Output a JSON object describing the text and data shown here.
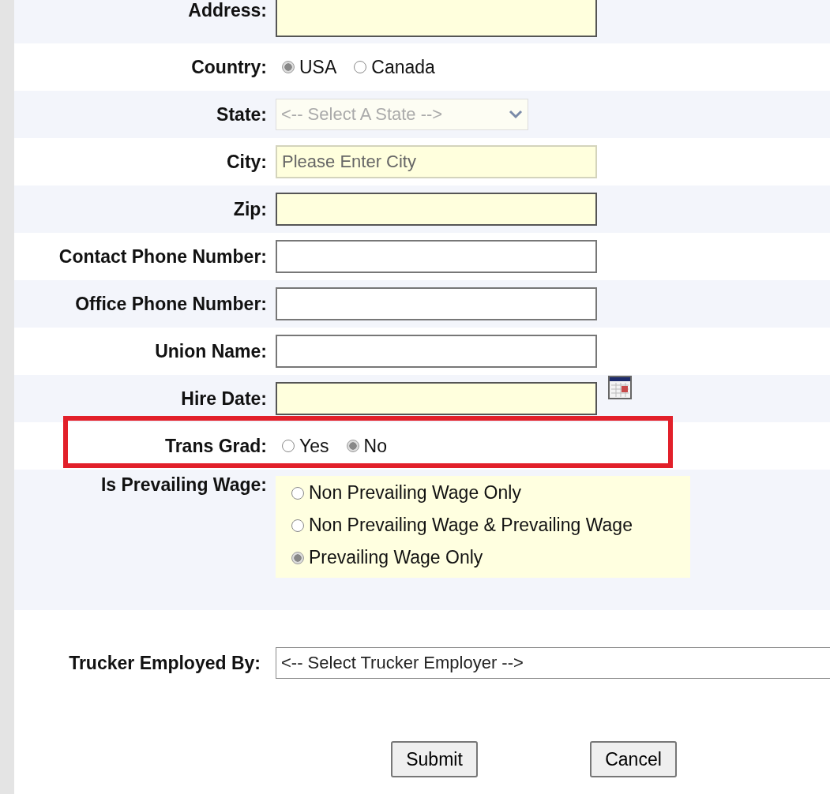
{
  "fields": [
    {
      "kind": "text",
      "label": "Address:",
      "required": true
    },
    {
      "kind": "radio",
      "label": "Country:",
      "options": [
        {
          "label": "USA",
          "selected": true
        },
        {
          "label": "Canada",
          "selected": false
        }
      ]
    },
    {
      "kind": "select",
      "label": "State:",
      "value": "<-- Select A State -->",
      "disabled": true
    },
    {
      "kind": "text",
      "label": "City:",
      "placeholder": "Please Enter City",
      "required": true,
      "disabled": true
    },
    {
      "kind": "text",
      "label": "Zip:",
      "required": true
    },
    {
      "kind": "text",
      "label": "Contact Phone Number:",
      "required": false
    },
    {
      "kind": "text",
      "label": "Office Phone Number:",
      "required": false
    },
    {
      "kind": "text",
      "label": "Union Name:",
      "required": false
    },
    {
      "kind": "date",
      "label": "Hire Date:",
      "required": true
    },
    {
      "kind": "radio",
      "label": "Trans Grad:",
      "highlighted": true,
      "options": [
        {
          "label": "Yes",
          "selected": false
        },
        {
          "label": "No",
          "selected": true
        }
      ]
    },
    {
      "kind": "radio_list",
      "label": "Is Prevailing Wage:",
      "options": [
        {
          "label": "Non Prevailing Wage Only",
          "selected": false
        },
        {
          "label": "Non Prevailing Wage & Prevailing Wage",
          "selected": false
        },
        {
          "label": "Prevailing Wage Only",
          "selected": true
        }
      ]
    },
    {
      "kind": "wide_select",
      "label": "Trucker Employed By:",
      "value": "<-- Select Trucker Employer -->",
      "disabled": false
    }
  ],
  "buttons": [
    "Submit",
    "Cancel"
  ]
}
